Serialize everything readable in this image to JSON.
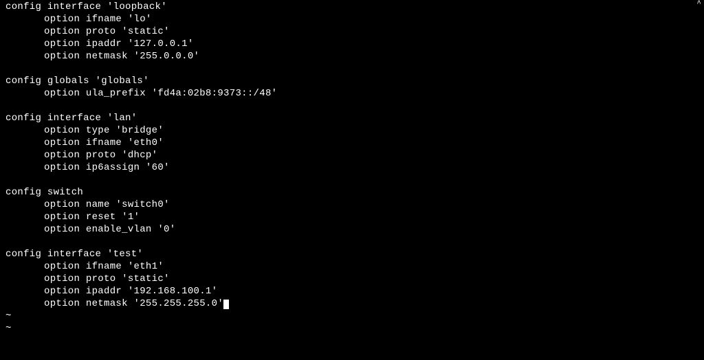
{
  "lines": [
    {
      "cls": "",
      "text": "config interface 'loopback'"
    },
    {
      "cls": "indent",
      "text": "option ifname 'lo'"
    },
    {
      "cls": "indent",
      "text": "option proto 'static'"
    },
    {
      "cls": "indent",
      "text": "option ipaddr '127.0.0.1'"
    },
    {
      "cls": "indent",
      "text": "option netmask '255.0.0.0'"
    },
    {
      "cls": "",
      "text": ""
    },
    {
      "cls": "",
      "text": "config globals 'globals'"
    },
    {
      "cls": "indent",
      "text": "option ula_prefix 'fd4a:02b8:9373::/48'"
    },
    {
      "cls": "",
      "text": ""
    },
    {
      "cls": "",
      "text": "config interface 'lan'"
    },
    {
      "cls": "indent",
      "text": "option type 'bridge'"
    },
    {
      "cls": "indent",
      "text": "option ifname 'eth0'"
    },
    {
      "cls": "indent",
      "text": "option proto 'dhcp'"
    },
    {
      "cls": "indent",
      "text": "option ip6assign '60'"
    },
    {
      "cls": "",
      "text": ""
    },
    {
      "cls": "",
      "text": "config switch"
    },
    {
      "cls": "indent",
      "text": "option name 'switch0'"
    },
    {
      "cls": "indent",
      "text": "option reset '1'"
    },
    {
      "cls": "indent",
      "text": "option enable_vlan '0'"
    },
    {
      "cls": "",
      "text": ""
    },
    {
      "cls": "",
      "text": "config interface 'test'"
    },
    {
      "cls": "indent",
      "text": "option ifname 'eth1'"
    },
    {
      "cls": "indent",
      "text": "option proto 'static'"
    },
    {
      "cls": "indent",
      "text": "option ipaddr '192.168.100.1'"
    },
    {
      "cls": "indent",
      "text": "option netmask '255.255.255.0'",
      "cursor": true
    }
  ],
  "tildes": [
    "~",
    "~"
  ],
  "scroll_arrow": "^"
}
